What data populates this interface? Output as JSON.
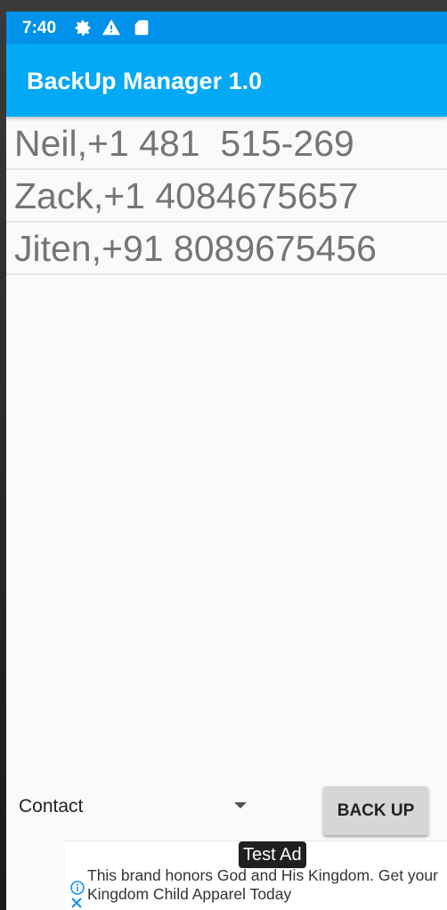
{
  "status_bar": {
    "time": "7:40",
    "icons": [
      "gear-icon",
      "warning-icon",
      "sd-card-icon"
    ]
  },
  "app_bar": {
    "title": "BackUp Manager 1.0"
  },
  "contacts": [
    {
      "text": "Neil,+1 481  515-269"
    },
    {
      "text": "Zack,+1 4084675657"
    },
    {
      "text": "Jiten,+91 8089675456"
    }
  ],
  "controls": {
    "spinner_value": "Contact",
    "backup_label": "BACK UP"
  },
  "ad": {
    "label": "Test Ad",
    "text": "This brand honors God and His Kingdom. Get your Kingdom Child Apparel Today"
  },
  "colors": {
    "status_bar": "#0091ea",
    "app_bar": "#03a9f4",
    "list_text": "#757575",
    "button": "#d6d6d6",
    "ad_icon": "#0b8df0"
  }
}
